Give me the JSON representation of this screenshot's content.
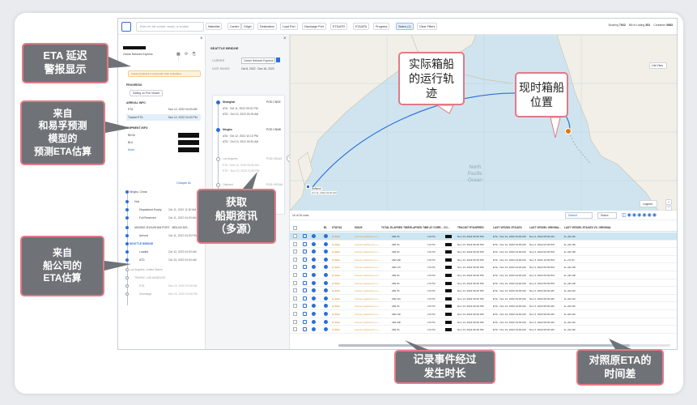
{
  "callouts": {
    "eta_delay": [
      "ETA 延迟",
      "警报显示"
    ],
    "model_eta": [
      "来自",
      "和易孚预测",
      "模型的",
      "预测ETA估算"
    ],
    "carrier_eta": [
      "来自",
      "船公司的",
      "ETA估算"
    ],
    "schedule": [
      "获取",
      "船期资讯",
      "（多源）"
    ],
    "track": [
      "实际箱船",
      "的运行轨",
      "迹"
    ],
    "position": [
      "现时箱船",
      "位置"
    ],
    "elapsed": [
      "记录事件经过",
      "发生时长"
    ],
    "eta_diff": [
      "对照原ETA的",
      "时间差"
    ]
  },
  "topbar": {
    "search_placeholder": "Enter ref, bill number, vessel, or location",
    "filters": [
      "Watchlist",
      "Carrier",
      "Origin",
      "Destination",
      "Load Port",
      "Discharge Port",
      "ETD/ATD",
      "ETA/ATA",
      "Progress",
      "Status (1)",
      "Clear Filters"
    ],
    "counts": [
      {
        "label": "Booking",
        "value": "7922"
      },
      {
        "label": "Bill of Lading",
        "value": "351"
      },
      {
        "label": "Container",
        "value": "3983"
      }
    ]
  },
  "detail": {
    "subtitle": "Ocean Network Express",
    "warning": "Vessel predicted to arrive later than scheduled",
    "progress_label": "PROGRESS",
    "progress_value": "Sailing on Port Vessel",
    "arrival_label": "ARRIVAL INFO",
    "eta_label": "ETA",
    "eta_value": "Nov 12, 2022 04:00 AM",
    "tracked_eta_label": "Tracket ETA",
    "tracked_eta_value": "Nov 12, 2022 04:00 PM",
    "shipment_label": "SHIPMENT INFO",
    "bkg_label": "BKG#",
    "bl_label": "BL#",
    "more": "More...",
    "collapse": "Collapse All",
    "events": [
      {
        "label": "Ningbo, China",
        "time": ""
      },
      {
        "label": "Hub",
        "time": ""
      },
      {
        "label": "Dispatched Empty",
        "time": "Oct 11, 2022 11:30 AM"
      },
      {
        "label": "Full Received",
        "time": "Oct 11, 2022 04:00 AM"
      },
      {
        "label": "NINGBO ZHOUSHAN PORT - BEILUN DIS...",
        "time": ""
      },
      {
        "label": "Arrived",
        "time": "Oct 11, 2022 04:00 PM"
      },
      {
        "label": "SEATTLE BRIDGE",
        "time": ""
      },
      {
        "label": "Loaded",
        "time": "Oct 12, 2022 04:00 AM"
      },
      {
        "label": "ATD",
        "time": "Oct 13, 2022 04:00 AM"
      },
      {
        "label": "Los Angeles, United States",
        "time": ""
      },
      {
        "label": "TRAPAC LOS ANGELES",
        "time": ""
      },
      {
        "label": "ETA",
        "time": "Nov 12, 2022 04:00 AM"
      },
      {
        "label": "Discharge",
        "time": "Nov 12, 2022 04:00 PM"
      }
    ]
  },
  "vessel": {
    "title": "SEATTLE BRIDGE",
    "carrier_label": "CARRIER",
    "carrier_value": "Ocean Network Express",
    "date_label": "DATE RANGE",
    "date_value": "Oct 8, 2022 - Dec 16, 2022",
    "ports": [
      {
        "name": "Shanghai",
        "code": "POD CNSE",
        "ata": "ATA · Oct 11, 2022 05:31 PM",
        "atd": "ATD · Oct 12, 2022 00:33 AM"
      },
      {
        "name": "Ningbo",
        "code": "POD CNNB",
        "ata": "ATA · Oct 12, 2022 10:13 PM",
        "atd": "ATD · Oct 13, 2022 00:51 AM"
      },
      {
        "name": "Los Angeles",
        "code": "POD USLAX",
        "ata": "ETA · Nov 12, 2022 05:00 AM",
        "atd": "ETD · Nov 12, 2022 10:00 PM"
      },
      {
        "name": "Oakland",
        "code": "POD USOAK",
        "ata": "ETA · Nov 15, 2022 04:00 AM",
        "atd": "ETD · Nov 16, 2022 04:00 PM"
      }
    ]
  },
  "map": {
    "list_view": "List View",
    "legend": "Legend",
    "ocean_label": [
      "North",
      "Pacific",
      "Ocean"
    ],
    "origin_label": "Ashland",
    "origin_time": "Oct 11, 2022 04:00 AM",
    "track_color": "#2b6fd8",
    "vessel_color": "#e07b00"
  },
  "table": {
    "rows_count": "16 of 16 rows",
    "view": "Default",
    "status_filter": "Status",
    "headers": [
      "BL",
      "STATUS",
      "ISSUE",
      "TOTAL ELAPSED TIME",
      "ELAPSED TIME AT CURR...",
      "CO...",
      "TRACKIT ETA/SPEED",
      "LAST VESSEL ETA/ATA",
      "LAST VESSEL ORIGINA...",
      "LAST VESSEL ETA/ATA VS. ORIGINAL"
    ],
    "rows": [
      {
        "status": "At Risk",
        "issue": "Vessel predicted to a...",
        "total": "28d 3h",
        "curr": "17d 5h",
        "trackit": "Nov 13, 2022 09:20 PM",
        "last_eta": "ETA · Nov 12, 2022 04:00 AM",
        "orig": "Nov 2, 2022 08:00 AM",
        "diff": "E +9d 21h"
      },
      {
        "status": "At Risk",
        "issue": "Vessel predicted to a...",
        "total": "28d 4h",
        "curr": "17d 5h",
        "trackit": "Nov 13, 2022 09:20 PM",
        "last_eta": "ETA · Nov 12, 2022 04:00 AM",
        "orig": "Nov 2, 2022 02:00 PM",
        "diff": "E +9d 15h"
      },
      {
        "status": "At Risk",
        "issue": "Vessel predicted to a...",
        "total": "28d 9h",
        "curr": "17d 5h",
        "trackit": "Nov 13, 2022 09:20 PM",
        "last_eta": "ETA · Nov 12, 2022 04:00 AM",
        "orig": "Nov 2, 2022 02:00 PM",
        "diff": "E +9d 15h"
      },
      {
        "status": "At Risk",
        "issue": "Vessel predicted to a...",
        "total": "28d 16h",
        "curr": "17d 5h",
        "trackit": "Nov 13, 2022 09:20 PM",
        "last_eta": "ETA · Nov 12, 2022 04:00 AM",
        "orig": "Nov 3, 2022 10:00 PM",
        "diff": "E +7d 9h"
      },
      {
        "status": "At Risk",
        "issue": "Vessel predicted to a...",
        "total": "28d 17h",
        "curr": "17d 5h",
        "trackit": "Nov 13, 2022 09:20 PM",
        "last_eta": "ETA · Nov 12, 2022 04:00 AM",
        "orig": "Nov 2, 2022 06:00 PM",
        "diff": "E +9d 10h"
      },
      {
        "status": "At Risk",
        "issue": "Vessel predicted to a...",
        "total": "28d 9h",
        "curr": "17d 5h",
        "trackit": "Nov 13, 2022 09:20 PM",
        "last_eta": "ETA · Nov 12, 2022 04:00 AM",
        "orig": "Nov 2, 2022 06:00 PM",
        "diff": "E +9d 10h"
      },
      {
        "status": "At Risk",
        "issue": "Vessel predicted to a...",
        "total": "28d 9h",
        "curr": "17d 5h",
        "trackit": "Nov 13, 2022 09:20 PM",
        "last_eta": "ETA · Nov 12, 2022 04:00 AM",
        "orig": "Nov 2, 2022 06:00 PM",
        "diff": "E +9d 10h"
      },
      {
        "status": "At Risk",
        "issue": "Vessel predicted to a...",
        "total": "28d 3h",
        "curr": "17d 5h",
        "trackit": "Nov 13, 2022 09:20 PM",
        "last_eta": "ETA · Nov 12, 2022 04:00 AM",
        "orig": "Nov 2, 2022 08:00 AM",
        "diff": "E +9d 21h"
      },
      {
        "status": "At Risk",
        "issue": "Vessel predicted to a...",
        "total": "28d 11h",
        "curr": "17d 5h",
        "trackit": "Nov 13, 2022 09:20 PM",
        "last_eta": "ETA · Nov 12, 2022 04:00 AM",
        "orig": "Nov 2, 2022 08:00 AM",
        "diff": "E +9d 21h"
      },
      {
        "status": "At Risk",
        "issue": "Vessel predicted to a...",
        "total": "28d 3h",
        "curr": "17d 5h",
        "trackit": "Nov 13, 2022 09:20 PM",
        "last_eta": "ETA · Nov 12, 2022 04:00 AM",
        "orig": "Nov 2, 2022 08:00 AM",
        "diff": "E +9d 21h"
      },
      {
        "status": "At Risk",
        "issue": "Vessel predicted to a...",
        "total": "28d 14h",
        "curr": "17d 5h",
        "trackit": "Nov 13, 2022 09:20 PM",
        "last_eta": "ETA · Nov 12, 2022 04:00 AM",
        "orig": "Nov 2, 2022 08:00 AM",
        "diff": "E +9d 21h"
      },
      {
        "status": "At Risk",
        "issue": "Vessel predicted to a...",
        "total": "28d 20h",
        "curr": "17d 5h",
        "trackit": "Nov 13, 2022 09:20 PM",
        "last_eta": "ETA · Nov 12, 2022 04:00 AM",
        "orig": "Nov 2, 2022 08:00 AM",
        "diff": "E +9d 21h"
      },
      {
        "status": "At Risk",
        "issue": "Vessel predicted to a...",
        "total": "28d 4h",
        "curr": "17d 5h",
        "trackit": "Nov 13, 2022 09:20 PM",
        "last_eta": "ETA · Nov 12, 2022 04:00 AM",
        "orig": "Nov 2, 2022 08:00 AM",
        "diff": "E +9d 21h"
      }
    ]
  }
}
